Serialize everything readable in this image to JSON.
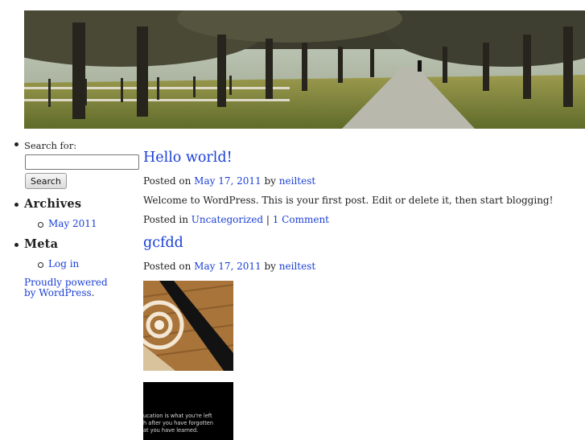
{
  "sidebar": {
    "search": {
      "label": "Search for:",
      "button": "Search",
      "value": ""
    },
    "archives": {
      "title": "Archives",
      "items": [
        "May 2011"
      ]
    },
    "meta": {
      "title": "Meta",
      "items": [
        "Log in"
      ]
    },
    "powered": {
      "link": "Proudly powered by WordPress",
      "suffix": "."
    }
  },
  "posts": [
    {
      "title": "Hello world!",
      "posted_on": "Posted on",
      "date": "May 17, 2011",
      "by": "by",
      "author": "neiltest",
      "text": "Welcome to WordPress. This is your first post. Edit or delete it, then start blogging!",
      "posted_in": "Posted in",
      "category": "Uncategorized",
      "separator": "|",
      "comments": "1 Comment"
    },
    {
      "title": "gcfdd",
      "posted_on": "Posted on",
      "date": "May 17, 2011",
      "by": "by",
      "author": "neiltest",
      "image2_text": [
        "ucation is what you're left",
        "h after you have forgotten",
        "at you have learned."
      ]
    }
  ]
}
